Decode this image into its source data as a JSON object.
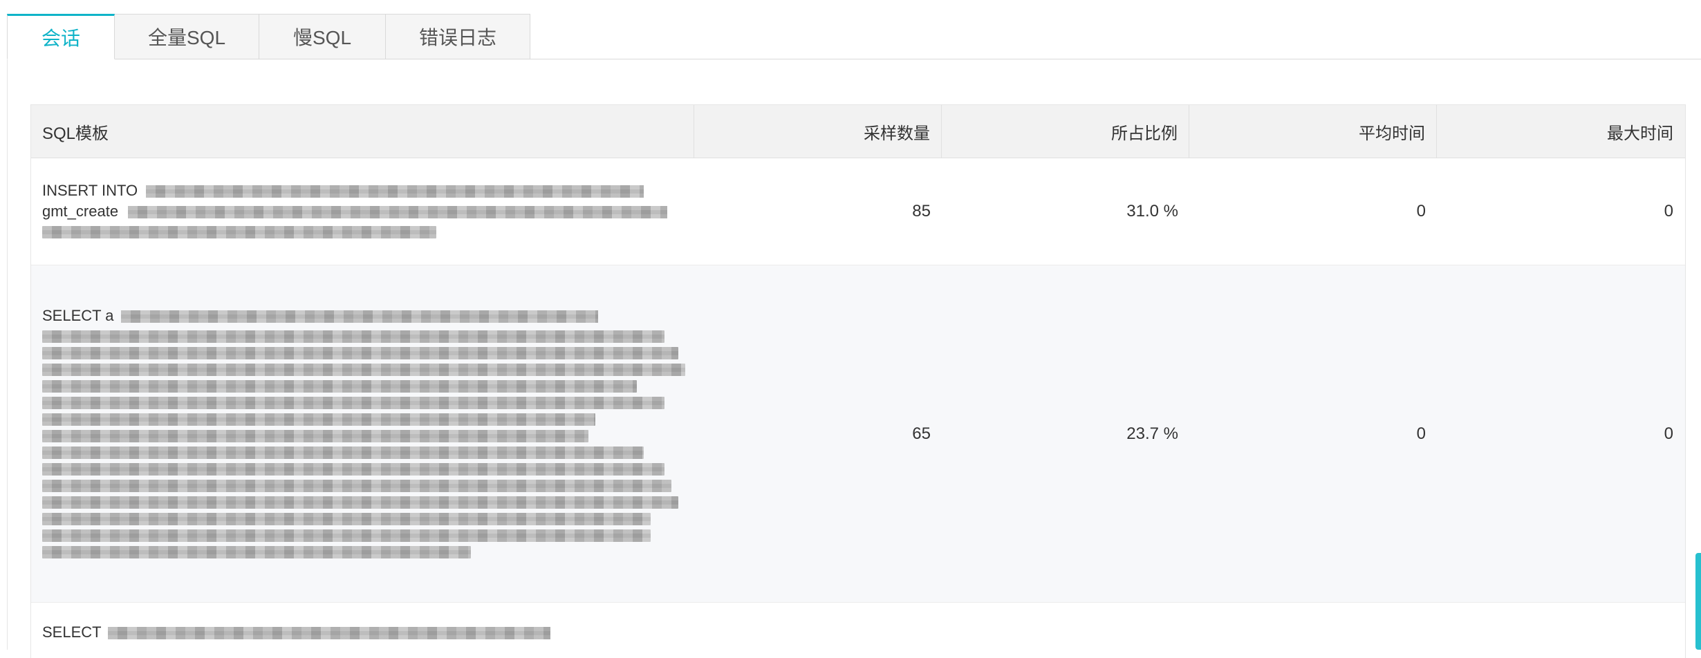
{
  "tabs": [
    {
      "label": "会话",
      "active": true
    },
    {
      "label": "全量SQL",
      "active": false
    },
    {
      "label": "慢SQL",
      "active": false
    },
    {
      "label": "错误日志",
      "active": false
    }
  ],
  "table": {
    "headers": [
      "SQL模板",
      "采样数量",
      "所占比例",
      "平均时间",
      "最大时间"
    ],
    "rows": [
      {
        "sql_prefix": "INSERT INTO",
        "sql_line2": "gmt_create",
        "count": "85",
        "ratio": "31.0 %",
        "avg": "0",
        "max": "0"
      },
      {
        "sql_prefix": "SELECT a",
        "count": "65",
        "ratio": "23.7 %",
        "avg": "0",
        "max": "0"
      },
      {
        "sql_prefix": "SELECT",
        "count": "",
        "ratio": "",
        "avg": "",
        "max": ""
      }
    ]
  },
  "colors": {
    "accent": "#0fb3c8",
    "header_bg": "#f2f2f2",
    "row_alt_bg": "#f7f8fa"
  }
}
